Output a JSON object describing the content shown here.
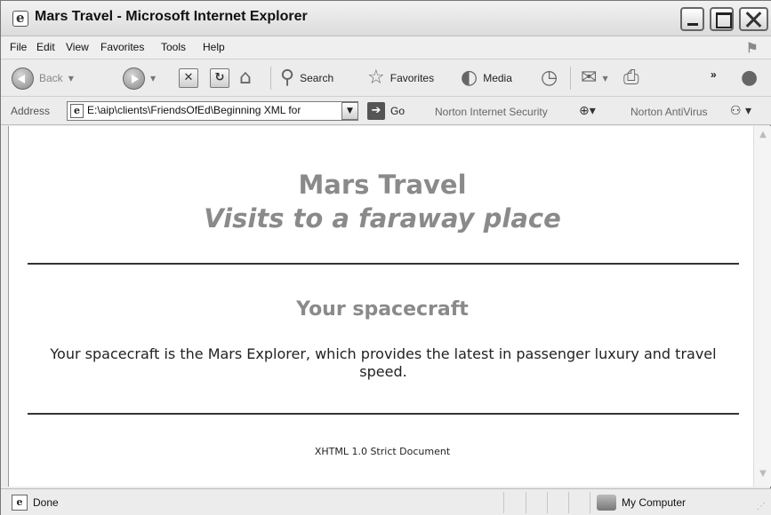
{
  "window": {
    "title": "Mars Travel - Microsoft Internet Explorer"
  },
  "menu": {
    "items": [
      "File",
      "Edit",
      "View",
      "Favorites",
      "Tools",
      "Help"
    ]
  },
  "toolbar": {
    "back_label": "Back",
    "search_label": "Search",
    "favorites_label": "Favorites",
    "media_label": "Media",
    "overflow_label": "»"
  },
  "address": {
    "label": "Address",
    "value": "E:\\aip\\clients\\FriendsOfEd\\Beginning XML for",
    "go_label": "Go",
    "norton_security": "Norton Internet Security",
    "norton_antivirus": "Norton AntiVirus"
  },
  "page": {
    "title": "Mars Travel",
    "subtitle": "Visits to a faraway place",
    "section_title": "Your spacecraft",
    "paragraph": "Your spacecraft is the Mars Explorer, which provides the latest in passenger luxury and travel speed.",
    "footer_note": "XHTML 1.0 Strict Document"
  },
  "status": {
    "text": "Done",
    "zone": "My Computer"
  },
  "icons": {
    "title": "ie-page-icon",
    "back": "back-arrow-icon",
    "forward": "forward-arrow-icon",
    "stop": "stop-icon",
    "refresh": "refresh-icon",
    "home": "home-icon",
    "search": "search-icon",
    "favorites": "favorites-star-icon",
    "media": "media-icon",
    "history": "history-icon",
    "mail": "mail-icon",
    "print": "print-icon",
    "messenger": "messenger-icon"
  }
}
